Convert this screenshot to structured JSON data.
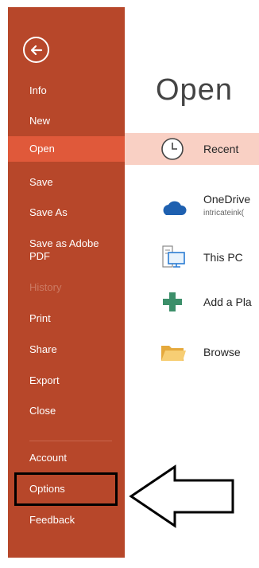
{
  "sidebar": {
    "items": [
      {
        "label": "Info"
      },
      {
        "label": "New"
      },
      {
        "label": "Open"
      },
      {
        "label": "Save"
      },
      {
        "label": "Save As"
      },
      {
        "label": "Save as Adobe PDF"
      },
      {
        "label": "History"
      },
      {
        "label": "Print"
      },
      {
        "label": "Share"
      },
      {
        "label": "Export"
      },
      {
        "label": "Close"
      },
      {
        "label": "Account"
      },
      {
        "label": "Options"
      },
      {
        "label": "Feedback"
      }
    ],
    "active_item": "Open",
    "disabled_item": "History"
  },
  "main": {
    "title": "Open",
    "locations": [
      {
        "label": "Recent",
        "icon": "clock-icon"
      },
      {
        "label": "OneDrive",
        "sublabel": "intricateink(",
        "icon": "cloud-icon"
      },
      {
        "label": "This PC",
        "icon": "computer-icon"
      },
      {
        "label": "Add a Pla",
        "icon": "plus-icon"
      },
      {
        "label": "Browse",
        "icon": "folder-icon"
      }
    ]
  },
  "colors": {
    "sidebar": "#b7472a",
    "active": "#e0593a",
    "selected_row": "#f9d0c4",
    "cloud": "#1e60b0",
    "plus": "#3c8f6a",
    "folder": "#f2c26b"
  }
}
